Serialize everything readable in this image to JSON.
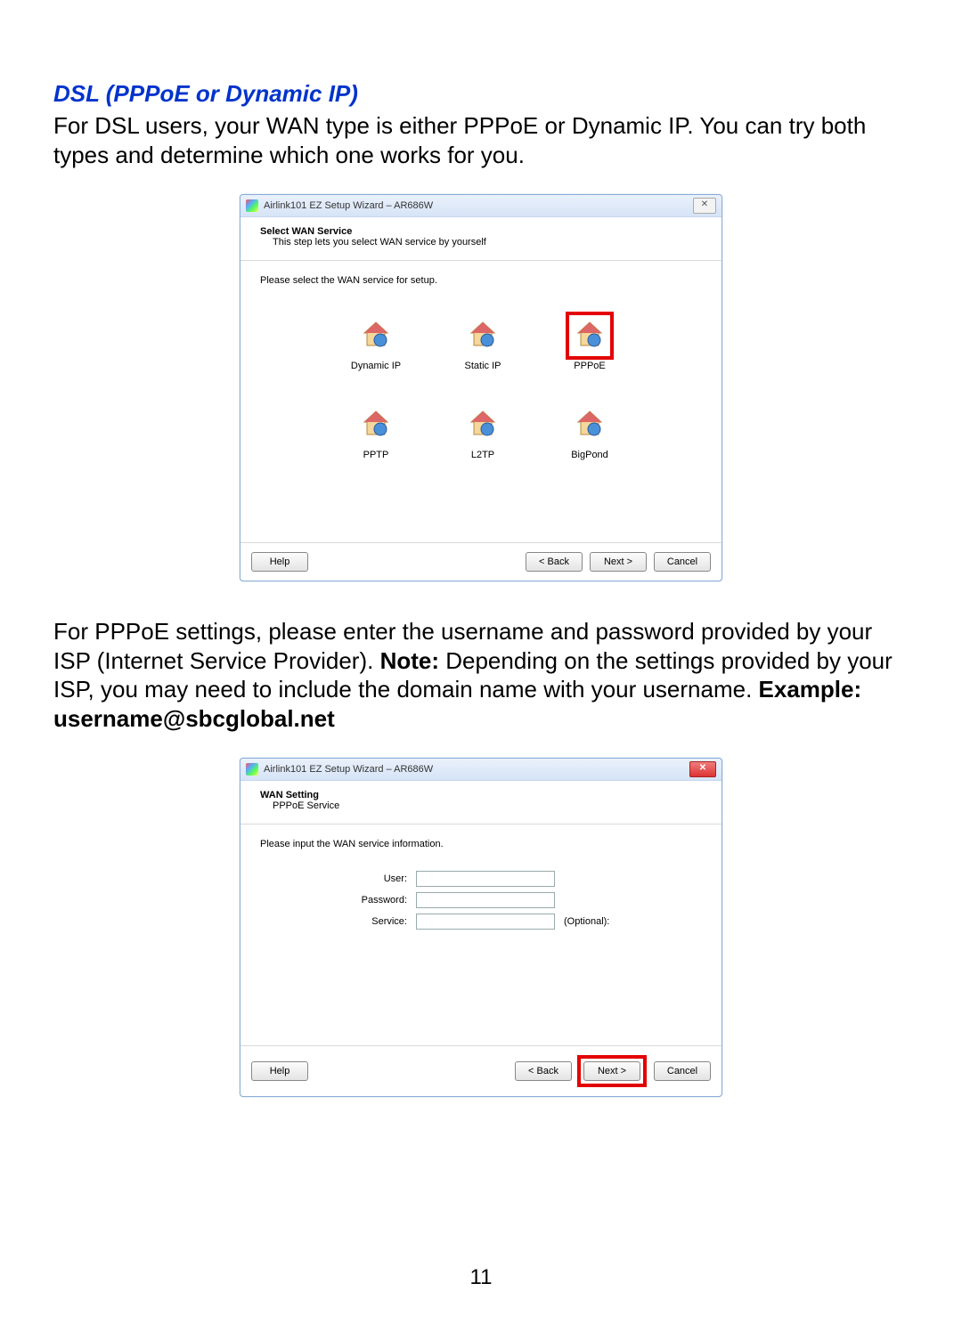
{
  "doc": {
    "section_title": "DSL (PPPoE or Dynamic IP)",
    "intro": "For DSL users, your WAN type is either PPPoE or Dynamic IP. You can try both types and determine which one works for you.",
    "para2_a": "For PPPoE settings, please enter the username and password provided by your ISP (Internet Service Provider).  ",
    "para2_note_label": "Note: ",
    "para2_b": "Depending on the settings provided by your ISP, you may need to include the domain name with your username.  ",
    "para2_example_label": "Example:  username@sbcglobal.net",
    "page_number": "11"
  },
  "wiz1": {
    "title": "Airlink101 EZ Setup Wizard – AR686W",
    "close_glyph": "✕",
    "header_title": "Select WAN Service",
    "header_sub": "This step lets you select WAN service by yourself",
    "prompt": "Please select the WAN service for setup.",
    "options": {
      "dynamic_ip": "Dynamic IP",
      "static_ip": "Static IP",
      "pppoe": "PPPoE",
      "pptp": "PPTP",
      "l2tp": "L2TP",
      "bigpond": "BigPond"
    },
    "buttons": {
      "help": "Help",
      "back": "< Back",
      "next": "Next >",
      "cancel": "Cancel"
    }
  },
  "wiz2": {
    "title": "Airlink101 EZ Setup Wizard – AR686W",
    "close_glyph": "✕",
    "header_title": "WAN Setting",
    "header_sub": "PPPoE Service",
    "prompt": "Please input the WAN service information.",
    "fields": {
      "user_label": "User:",
      "password_label": "Password:",
      "service_label": "Service:",
      "service_suffix": "(Optional):",
      "user_value": "",
      "password_value": "",
      "service_value": ""
    },
    "buttons": {
      "help": "Help",
      "back": "< Back",
      "next": "Next >",
      "cancel": "Cancel"
    }
  }
}
